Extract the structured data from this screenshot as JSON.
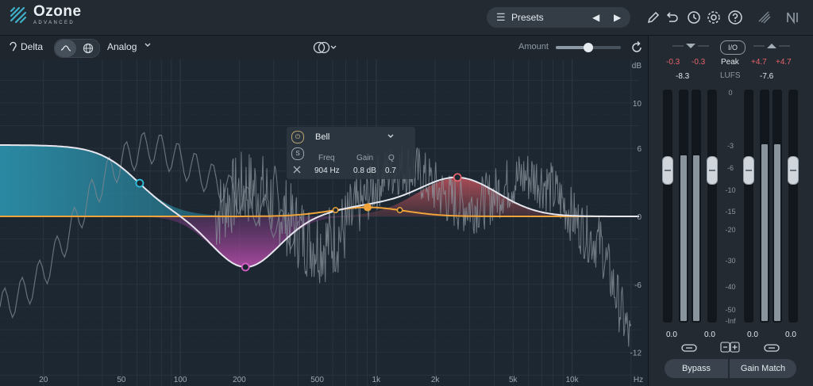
{
  "app": {
    "name": "Ozone",
    "edition": "ADVANCED"
  },
  "presets": {
    "label": "Presets",
    "prev": "◀",
    "next": "▶",
    "list_icon": "☰"
  },
  "colors": {
    "accent": "#f0a43a",
    "teal": "#2c9bb8",
    "magenta": "#c04fb0",
    "red": "#e5636a",
    "curve": "#e6e6ee",
    "bg": "#1b222a"
  },
  "toolbar": {
    "delta_label": "Delta",
    "mode_label": "Analog",
    "amount_label": "Amount",
    "amount_value": 0.5
  },
  "eq": {
    "db_unit": "dB",
    "freq_unit": "Hz",
    "db_ticks": [
      "10",
      "6",
      "0",
      "-6",
      "-12"
    ],
    "freq_ticks": [
      "20",
      "50",
      "100",
      "200",
      "500",
      "1k",
      "2k",
      "5k",
      "10k"
    ]
  },
  "band_popup": {
    "type": "Bell",
    "freq_label": "Freq",
    "gain_label": "Gain",
    "q_label": "Q",
    "freq_value": "904 Hz",
    "gain_value": "0.8 dB",
    "q_value": "0.7",
    "solo_label": "S"
  },
  "meters": {
    "in_peak_left": "-0.3",
    "in_peak_right": "-0.3",
    "in_lufs": "-8.3",
    "out_peak_left": "+4.7",
    "out_peak_right": "+4.7",
    "out_lufs": "-7.6",
    "io_label": "I/O",
    "peak_label": "Peak",
    "lufs_label": "LUFS",
    "scale": [
      "0",
      "-3",
      "-6",
      "-10",
      "-15",
      "-20",
      "-30",
      "-40",
      "-50",
      "-Inf"
    ],
    "in_gain_left": "0.0",
    "in_gain_right": "0.0",
    "out_gain_left": "0.0",
    "out_gain_right": "0.0",
    "in_level": 0.72,
    "out_level": 0.77,
    "bypass_label": "Bypass",
    "gain_match_label": "Gain Match"
  }
}
